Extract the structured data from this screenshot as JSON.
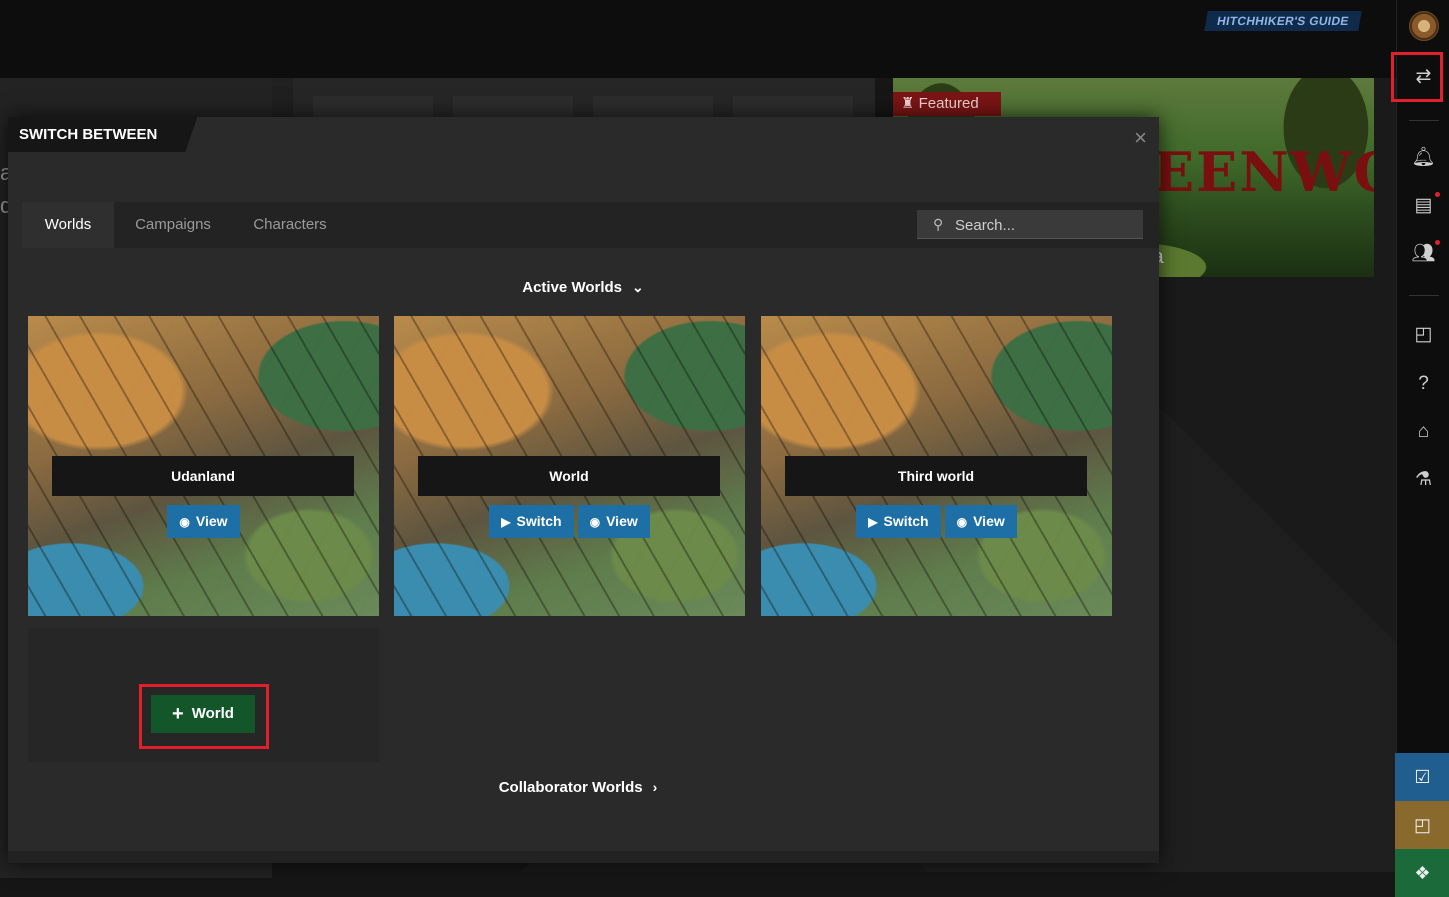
{
  "header": {
    "guide_badge": "HITCHHIKER'S GUIDE"
  },
  "featured": {
    "tag": "Featured",
    "title_fragment": "EENWO",
    "subtitle_fragment": "ia"
  },
  "modal": {
    "title": "SWITCH BETWEEN",
    "close_glyph": "×",
    "tabs": [
      "Worlds",
      "Campaigns",
      "Characters"
    ],
    "active_tab": "Worlds",
    "search_placeholder": "Search...",
    "active_section_label": "Active Worlds",
    "worlds": [
      {
        "name": "Udanland",
        "buttons": [
          "View"
        ]
      },
      {
        "name": "World",
        "buttons": [
          "Switch",
          "View"
        ]
      },
      {
        "name": "Third world",
        "buttons": [
          "Switch",
          "View"
        ]
      }
    ],
    "add_world_label": "World",
    "collaborator_section_label": "Collaborator Worlds"
  },
  "sidebar": {
    "icons": [
      "avatar",
      "switch-icon",
      "bell-icon",
      "news-icon",
      "users-icon",
      "note-icon",
      "help-icon",
      "hat-icon",
      "flask-icon",
      "check-icon",
      "sticky-note-icon",
      "dragon-icon"
    ]
  },
  "colors": {
    "accent_blue": "#1e6fa6",
    "add_green": "#12562a",
    "highlight_red": "#e0202c",
    "featured_red": "#7a1515"
  }
}
